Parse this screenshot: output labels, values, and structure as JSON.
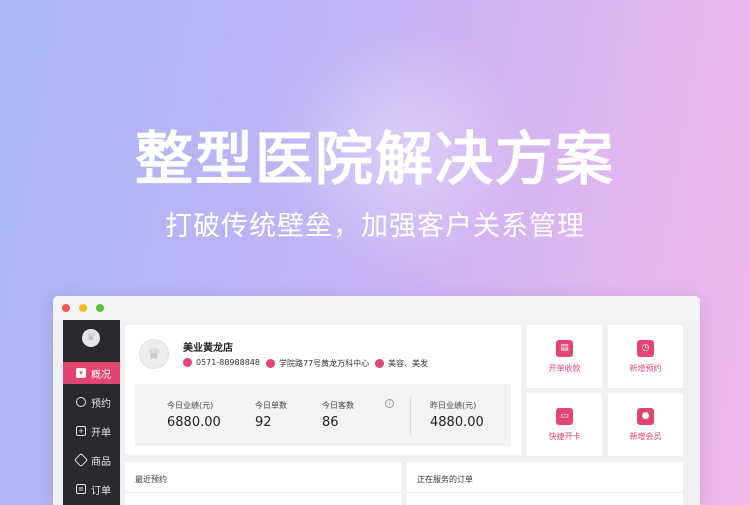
{
  "hero": {
    "title": "整型医院解决方案",
    "subtitle": "打破传统壁垒，加强客户关系管理"
  },
  "colors": {
    "accent": "#e2456f",
    "sidebar_bg": "#2a2a2e"
  },
  "sidebar": {
    "logo_icon": "crown-icon",
    "items": [
      {
        "label": "概况",
        "icon": "chat-icon",
        "active": true
      },
      {
        "label": "预约",
        "icon": "clock-icon",
        "active": false
      },
      {
        "label": "开单",
        "icon": "plus-square-icon",
        "active": false
      },
      {
        "label": "商品",
        "icon": "tag-icon",
        "active": false
      },
      {
        "label": "订单",
        "icon": "document-icon",
        "active": false
      }
    ]
  },
  "store": {
    "name": "美业黄龙店",
    "phone": "0571-88988848",
    "address": "学院路77号黄龙万科中心",
    "category": "美容、美发"
  },
  "stats": [
    {
      "label": "今日业绩(元)",
      "value": "6880.00"
    },
    {
      "label": "今日单数",
      "value": "92"
    },
    {
      "label": "今日客数",
      "value": "86"
    },
    {
      "label": "昨日业绩(元)",
      "value": "4880.00"
    }
  ],
  "quick_actions": [
    {
      "label": "开单收款",
      "icon": "receipt-icon"
    },
    {
      "label": "新增预约",
      "icon": "clock-icon"
    },
    {
      "label": "快捷开卡",
      "icon": "card-icon"
    },
    {
      "label": "新增会员",
      "icon": "user-icon"
    }
  ],
  "panels": {
    "recent_appointments": "最近预约",
    "serving_orders": "正在服务的订单"
  }
}
